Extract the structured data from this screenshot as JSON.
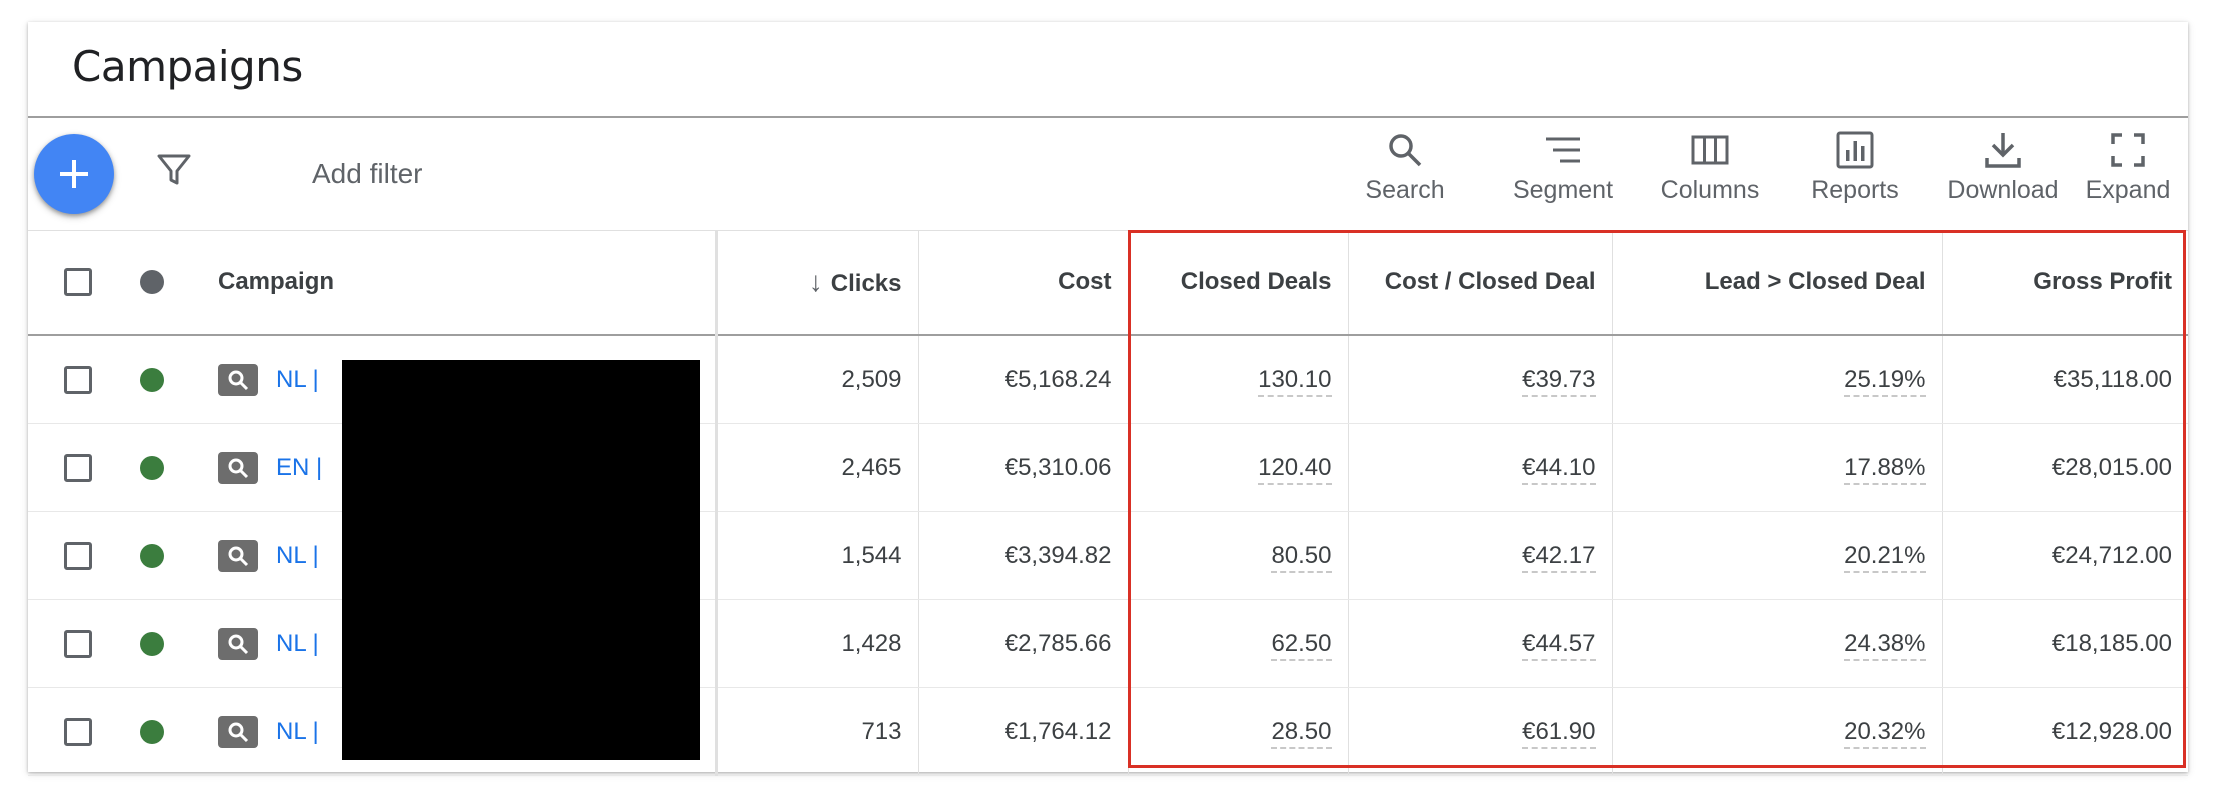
{
  "title": "Campaigns",
  "toolbar": {
    "add_filter": "Add filter",
    "tools": [
      {
        "label": "Search",
        "icon": "search-icon"
      },
      {
        "label": "Segment",
        "icon": "segment-icon"
      },
      {
        "label": "Columns",
        "icon": "columns-icon"
      },
      {
        "label": "Reports",
        "icon": "reports-icon"
      },
      {
        "label": "Download",
        "icon": "download-icon"
      },
      {
        "label": "Expand",
        "icon": "expand-icon"
      }
    ]
  },
  "table": {
    "headers": {
      "campaign": "Campaign",
      "clicks": "Clicks",
      "cost": "Cost",
      "closed_deals": "Closed Deals",
      "cost_per_closed_deal": "Cost / Closed Deal",
      "lead_to_closed": "Lead > Closed Deal",
      "gross_profit": "Gross Profit"
    },
    "sort_indicator": "↓",
    "rows": [
      {
        "campaign": "NL |",
        "clicks": "2,509",
        "cost": "€5,168.24",
        "closed_deals": "130.10",
        "cost_per_closed_deal": "€39.73",
        "lead_to_closed": "25.19%",
        "gross_profit": "€35,118.00"
      },
      {
        "campaign": "EN |",
        "clicks": "2,465",
        "cost": "€5,310.06",
        "closed_deals": "120.40",
        "cost_per_closed_deal": "€44.10",
        "lead_to_closed": "17.88%",
        "gross_profit": "€28,015.00"
      },
      {
        "campaign": "NL |",
        "clicks": "1,544",
        "cost": "€3,394.82",
        "closed_deals": "80.50",
        "cost_per_closed_deal": "€42.17",
        "lead_to_closed": "20.21%",
        "gross_profit": "€24,712.00"
      },
      {
        "campaign": "NL |",
        "clicks": "1,428",
        "cost": "€2,785.66",
        "closed_deals": "62.50",
        "cost_per_closed_deal": "€44.57",
        "lead_to_closed": "24.38%",
        "gross_profit": "€18,185.00"
      },
      {
        "campaign": "NL |",
        "clicks": "713",
        "cost": "€1,764.12",
        "closed_deals": "28.50",
        "cost_per_closed_deal": "€61.90",
        "lead_to_closed": "20.32%",
        "gross_profit": "€12,928.00"
      }
    ]
  },
  "colors": {
    "accent": "#4285f4",
    "status_enabled": "#3b7d3e",
    "status_header": "#5f6368",
    "link": "#1a73e8",
    "highlight": "#d93025"
  }
}
